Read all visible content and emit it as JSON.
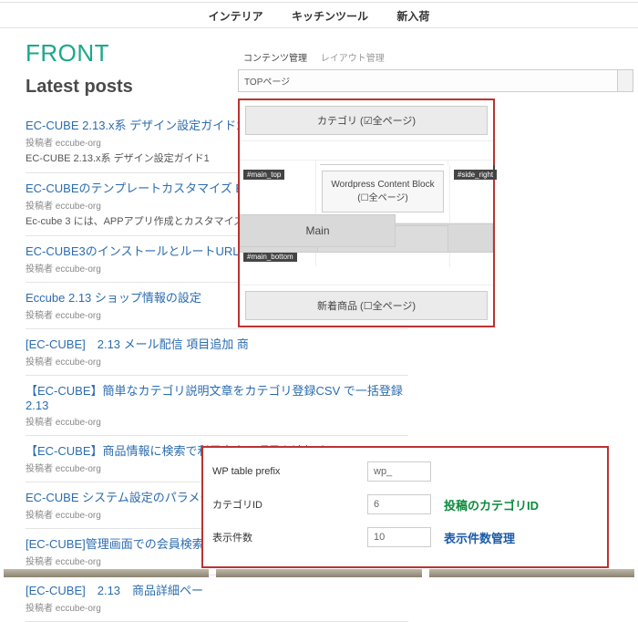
{
  "nav": {
    "items": [
      "インテリア",
      "キッチンツール",
      "新入荷"
    ]
  },
  "front": {
    "title": "FRONT",
    "latest": "Latest posts"
  },
  "posts": [
    {
      "title": "EC-CUBE 2.13.x系 デザイン設定ガイド1",
      "author": "投稿者 eccube-org",
      "excerpt": "EC-CUBE 2.13.x系 デザイン設定ガイド1"
    },
    {
      "title": "EC-CUBEのテンプレートカスタマイズ E",
      "author": "投稿者 eccube-org",
      "excerpt": "Ec-cube 3 には、APPアプリ作成とカスタマイズも"
    },
    {
      "title": "EC-CUBE3のインストールとルートURLの",
      "author": "投稿者 eccube-org"
    },
    {
      "title": "Eccube 2.13 ショップ情報の設定",
      "author": "投稿者 eccube-org"
    },
    {
      "title": "[EC-CUBE]　2.13 メール配信 項目追加 商",
      "author": "投稿者 eccube-org"
    },
    {
      "title": "【EC-CUBE】簡単なカテゴリ説明文章をカテゴリ登録CSV で一括登録 2.13",
      "author": "投稿者 eccube-org"
    },
    {
      "title": "【EC-CUBE】商品情報に検索で利用出来る項目を追加する 2.13",
      "author": "投稿者 eccube-org"
    },
    {
      "title": "EC-CUBE システム設定のパラメー",
      "author": "投稿者 eccube-org"
    },
    {
      "title": "[EC-CUBE]管理画面での会員検索",
      "author": "投稿者 eccube-org"
    },
    {
      "title": "[EC-CUBE]　2.13　商品詳細ペー",
      "author": "投稿者 eccube-org"
    }
  ],
  "admin": {
    "tabs": {
      "active": "コンテンツ管理",
      "inactive": "レイアウト管理"
    },
    "select": "TOPページ",
    "layout": {
      "top_bar": "カテゴリ (☑全ページ)",
      "main_top": "#main_top",
      "side_right": "#side_right",
      "wp_block": "Wordpress Content Block (☐全ページ)",
      "main": "Main",
      "main_bottom": "#main_bottom",
      "bottom_bar": "新着商品 (☐全ページ)"
    }
  },
  "settings": {
    "rows": [
      {
        "label": "WP table prefix",
        "value": "wp_",
        "note": ""
      },
      {
        "label": "カテゴリID",
        "value": "6",
        "note": "投稿のカテゴリID",
        "note_class": "green"
      },
      {
        "label": "表示件数",
        "value": "10",
        "note": "表示件数管理",
        "note_class": "blue"
      }
    ]
  }
}
